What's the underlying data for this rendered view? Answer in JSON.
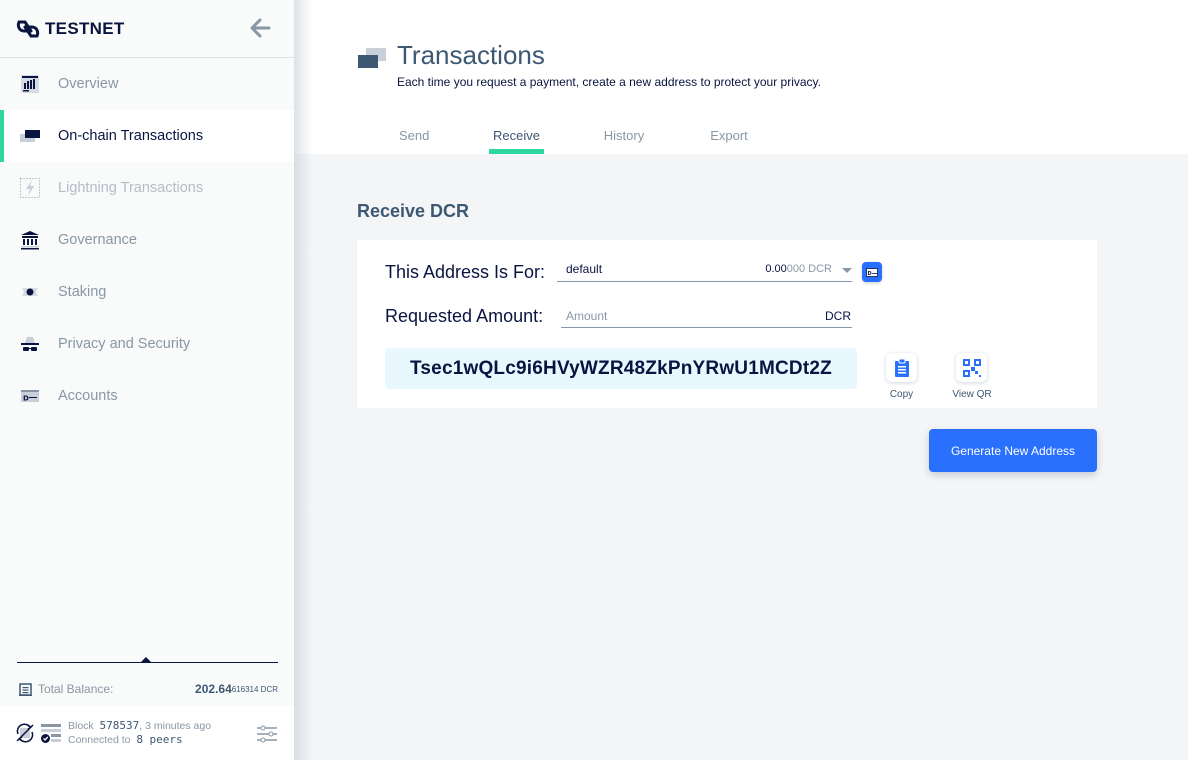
{
  "sidebar": {
    "logo_text": "TESTNET",
    "items": [
      {
        "label": "Overview",
        "icon": "overview-icon",
        "active": false
      },
      {
        "label": "On-chain Transactions",
        "icon": "transactions-icon",
        "active": true
      },
      {
        "label": "Lightning Transactions",
        "icon": "lightning-icon",
        "active": false,
        "disabled": true
      },
      {
        "label": "Governance",
        "icon": "governance-icon",
        "active": false
      },
      {
        "label": "Staking",
        "icon": "staking-icon",
        "active": false
      },
      {
        "label": "Privacy and Security",
        "icon": "privacy-icon",
        "active": false
      },
      {
        "label": "Accounts",
        "icon": "accounts-icon",
        "active": false
      }
    ],
    "balance": {
      "label": "Total Balance:",
      "main": "202.64",
      "small": "616314 DCR"
    },
    "status": {
      "block_label": "Block",
      "block_number": "578537",
      "block_age": ", 3 minutes ago",
      "connected_label": "Connected to",
      "peers": "8 peers"
    }
  },
  "header": {
    "title": "Transactions",
    "subtitle": "Each time you request a payment, create a new address to protect your privacy.",
    "tabs": [
      {
        "label": "Send",
        "active": false
      },
      {
        "label": "Receive",
        "active": true
      },
      {
        "label": "History",
        "active": false
      },
      {
        "label": "Export",
        "active": false
      }
    ]
  },
  "receive": {
    "section_title": "Receive DCR",
    "address_for_label": "This Address Is For:",
    "account": {
      "name": "default",
      "balance_main": "0.00",
      "balance_rest": "000 DCR"
    },
    "requested_amount_label": "Requested Amount:",
    "amount": {
      "placeholder": "Amount",
      "value": "",
      "unit": "DCR"
    },
    "address": "Tsec1wQLc9i6HVyWZR48ZkPnYRwU1MCDt2Z",
    "copy_label": "Copy",
    "view_qr_label": "View QR",
    "generate_label": "Generate New Address"
  },
  "colors": {
    "accent_green": "#2ed6a1",
    "primary_blue": "#2970ff",
    "dark_navy": "#091440",
    "muted_text": "#8997a5",
    "address_bg": "#e9f8fe"
  }
}
